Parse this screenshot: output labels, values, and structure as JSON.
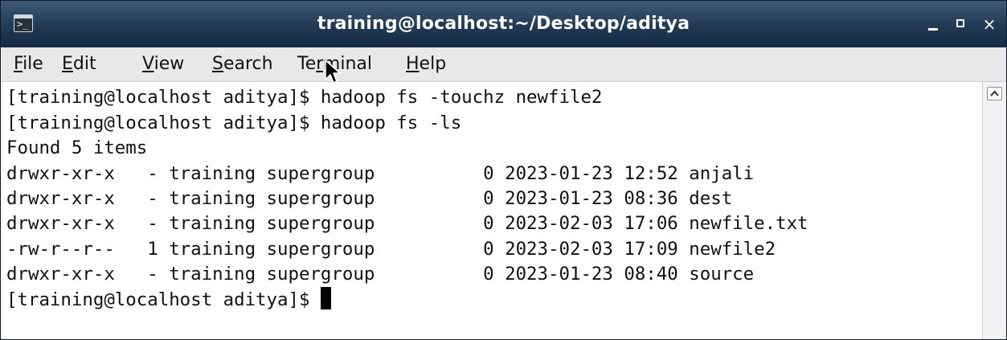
{
  "window": {
    "title": "training@localhost:~/Desktop/aditya",
    "icon": "terminal-icon",
    "controls": {
      "minimize": "minimize-icon",
      "maximize": "maximize-icon",
      "close": "×"
    }
  },
  "menu": {
    "items": [
      {
        "label": "File",
        "mnemonic": "F",
        "rest": "ile"
      },
      {
        "label": "Edit",
        "mnemonic": "E",
        "rest": "dit"
      },
      {
        "label": "View",
        "mnemonic": "V",
        "rest": "iew"
      },
      {
        "label": "Search",
        "mnemonic": "S",
        "rest": "earch"
      },
      {
        "label": "Terminal",
        "pre": "Te",
        "mnemonic": "r",
        "rest": "minal"
      },
      {
        "label": "Help",
        "mnemonic": "H",
        "rest": "elp"
      }
    ]
  },
  "terminal": {
    "lines": [
      "[training@localhost aditya]$ hadoop fs -touchz newfile2",
      "[training@localhost aditya]$ hadoop fs -ls",
      "Found 5 items",
      "drwxr-xr-x   - training supergroup          0 2023-01-23 12:52 anjali",
      "drwxr-xr-x   - training supergroup          0 2023-01-23 08:36 dest",
      "drwxr-xr-x   - training supergroup          0 2023-02-03 17:06 newfile.txt",
      "-rw-r--r--   1 training supergroup          0 2023-02-03 17:09 newfile2",
      "drwxr-xr-x   - training supergroup          0 2023-01-23 08:40 source"
    ],
    "prompt": "[training@localhost aditya]$ "
  },
  "scrollbar": {
    "up_icon": "chevron-up-icon"
  },
  "cursor_icon": "mouse-pointer-icon"
}
